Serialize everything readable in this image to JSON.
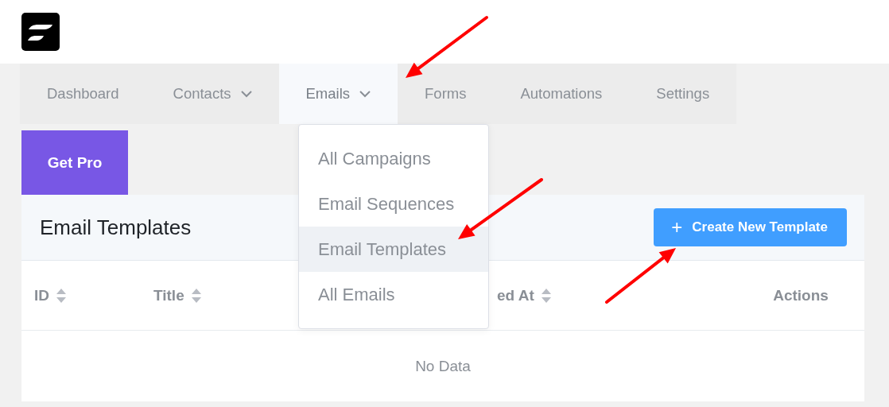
{
  "nav": [
    {
      "label": "Dashboard",
      "has_caret": false,
      "selected": false
    },
    {
      "label": "Contacts",
      "has_caret": true,
      "selected": false
    },
    {
      "label": "Emails",
      "has_caret": true,
      "selected": true
    },
    {
      "label": "Forms",
      "has_caret": false,
      "selected": false
    },
    {
      "label": "Automations",
      "has_caret": false,
      "selected": false
    },
    {
      "label": "Settings",
      "has_caret": false,
      "selected": false
    }
  ],
  "get_pro": "Get Pro",
  "dropdown": [
    {
      "label": "All Campaigns",
      "highlighted": false
    },
    {
      "label": "Email Sequences",
      "highlighted": false
    },
    {
      "label": "Email Templates",
      "highlighted": true
    },
    {
      "label": "All Emails",
      "highlighted": false
    }
  ],
  "page_title": "Email Templates",
  "create_button": {
    "icon": "+",
    "label": "Create New Template"
  },
  "table": {
    "columns": [
      {
        "label": "ID",
        "sortable": true
      },
      {
        "label": "Title",
        "sortable": true
      },
      {
        "label": "ed At",
        "sortable": true
      },
      {
        "label": "Actions",
        "sortable": false
      }
    ],
    "empty_text": "No Data"
  }
}
